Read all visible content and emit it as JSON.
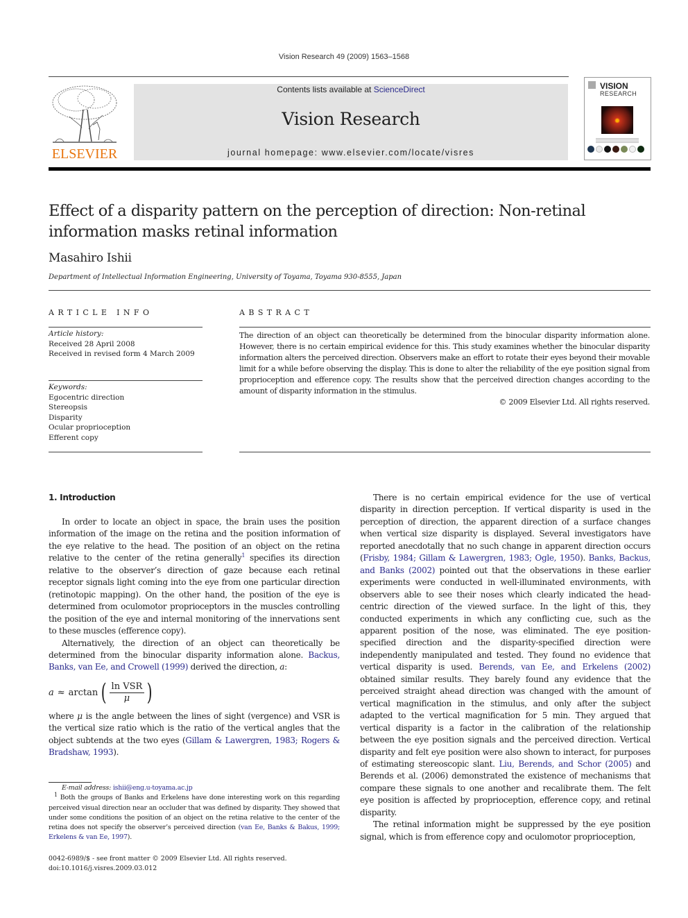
{
  "running_head": "Vision Research 49 (2009) 1563–1568",
  "header": {
    "publisher_logo_text": "ELSEVIER",
    "contents_prefix": "Contents lists available at ",
    "contents_link": "ScienceDirect",
    "journal_title": "Vision Research",
    "homepage_label": "journal homepage: www.elsevier.com/locate/visres",
    "cover": {
      "title_line1": "VISION",
      "title_line2": "RESEARCH"
    },
    "colors": {
      "elsevier_orange": "#e8750e",
      "banner_bg": "#e3e3e3",
      "link_blue": "#2a2a8c"
    }
  },
  "article": {
    "title": "Effect of a disparity pattern on the perception of direction: Non-retinal information masks retinal information",
    "author": "Masahiro Ishii",
    "affiliation": "Department of Intellectual Information Engineering, University of Toyama, Toyama 930-8555, Japan"
  },
  "article_info": {
    "heading": "ARTICLE INFO",
    "history_label": "Article history:",
    "history": [
      "Received 28 April 2008",
      "Received in revised form 4 March 2009"
    ],
    "keywords_label": "Keywords:",
    "keywords": [
      "Egocentric direction",
      "Stereopsis",
      "Disparity",
      "Ocular proprioception",
      "Efferent copy"
    ]
  },
  "abstract": {
    "heading": "ABSTRACT",
    "text": "The direction of an object can theoretically be determined from the binocular disparity information alone. However, there is no certain empirical evidence for this. This study examines whether the binocular disparity information alters the perceived direction. Observers make an effort to rotate their eyes beyond their movable limit for a while before observing the display. This is done to alter the reliability of the eye position signal from proprioception and efference copy. The results show that the perceived direction changes according to the amount of disparity information in the stimulus.",
    "copyright": "© 2009 Elsevier Ltd. All rights reserved."
  },
  "intro": {
    "heading": "1. Introduction",
    "p1_a": "In order to locate an object in space, the brain uses the position information of the image on the retina and the position information of the eye relative to the head. The position of an object on the retina relative to the center of the retina generally",
    "p1_sup": "1",
    "p1_b": " specifies its direction relative to the observer’s direction of gaze because each retinal receptor signals light coming into the eye from one particular direction (retinotopic mapping). On the other hand, the position of the eye is determined from oculomotor proprioceptors in the muscles controlling the position of the eye and internal monitoring of the innervations sent to these muscles (efference copy).",
    "p2_a": "Alternatively, the direction of an object can theoretically be determined from the binocular disparity information alone. ",
    "p2_link": "Backus, Banks, van Ee, and Crowell (1999)",
    "p2_b": " derived the direction, ",
    "p2_var": "a",
    "p2_c": ":",
    "equation": {
      "lhs": "a",
      "approx": "≈",
      "func": "arctan",
      "numerator": "ln VSR",
      "denominator": "μ"
    },
    "p3_a": "where ",
    "p3_var": "μ",
    "p3_b": " is the angle between the lines of sight (vergence) and VSR is the vertical size ratio which is the ratio of the vertical angles that the object subtends at the two eyes (",
    "p3_link": "Gillam & Lawergren, 1983; Rogers & Bradshaw, 1993",
    "p3_c": ")."
  },
  "right_col": {
    "p1_a": "There is no certain empirical evidence for the use of vertical disparity in direction perception. If vertical disparity is used in the perception of direction, the apparent direction of a surface changes when vertical size disparity is displayed. Several investigators have reported anecdotally that no such change in apparent direction occurs (",
    "p1_link1": "Frisby, 1984; Gillam & Lawergren, 1983; Ogle, 1950",
    "p1_b": "). ",
    "p1_link2": "Banks, Backus, and Banks (2002)",
    "p1_c": " pointed out that the observations in these earlier experiments were conducted in well-illuminated environments, with observers able to see their noses which clearly indicated the head-centric direction of the viewed surface. In the light of this, they conducted experiments in which any conflicting cue, such as the apparent position of the nose, was eliminated. The eye position-specified direction and the disparity-specified direction were independently manipulated and tested. They found no evidence that vertical disparity is used. ",
    "p1_link3": "Berends, van Ee, and Erkelens (2002)",
    "p1_d": " obtained similar results. They barely found any evidence that the perceived straight ahead direction was changed with the amount of vertical magnification in the stimulus, and only after the subject adapted to the vertical magnification for 5 min. They argued that vertical disparity is a factor in the calibration of the relationship between the eye position signals and the perceived direction. Vertical disparity and felt eye position were also shown to interact, for purposes of estimating stereoscopic slant. ",
    "p1_link4": "Liu, Berends, and Schor (2005)",
    "p1_e": " and Berends et al. (2006) demonstrated the existence of mechanisms that compare these signals to one another and recalibrate them. The felt eye position is affected by proprioception, efference copy, and retinal disparity.",
    "p2": "The retinal information might be suppressed by the eye position signal, which is from efference copy and oculomotor proprioception,"
  },
  "footnotes": {
    "email_label": "E-mail address: ",
    "email": "ishii@eng.u-toyama.ac.jp",
    "fn1_mark": "1",
    "fn1_a": " Both the groups of Banks and Erkelens have done interesting work on this regarding perceived visual direction near an occluder that was defined by disparity. They showed that under some conditions the position of an object on the retina relative to the center of the retina does not specify the observer’s perceived direction (",
    "fn1_link": "van Ee, Banks & Bakus, 1999; Erkelens & van Ee, 1997",
    "fn1_b": ")."
  },
  "bottom_meta": {
    "issn_line": "0042-6989/$ - see front matter © 2009 Elsevier Ltd. All rights reserved.",
    "doi": "doi:10.1016/j.visres.2009.03.012"
  }
}
